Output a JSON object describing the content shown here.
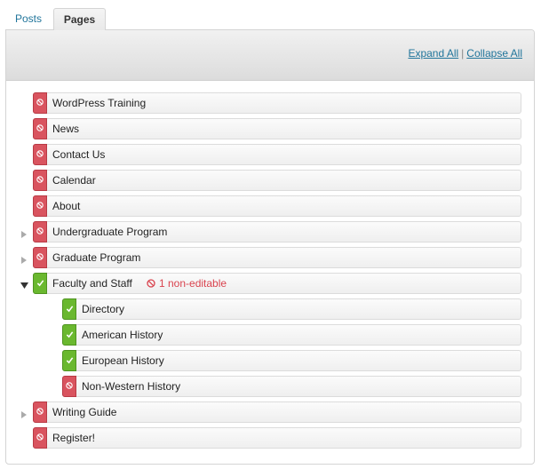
{
  "tabs": [
    {
      "label": "Posts",
      "active": false
    },
    {
      "label": "Pages",
      "active": true
    }
  ],
  "header": {
    "expand_all": "Expand All",
    "separator": "|",
    "collapse_all": "Collapse All"
  },
  "colors": {
    "link": "#21759b",
    "restricted": "#d9545f",
    "editable": "#6ab82f",
    "warning_text": "#d9434e"
  },
  "pages": [
    {
      "label": "WordPress Training",
      "status": "non-editable",
      "depth": 0
    },
    {
      "label": "News",
      "status": "non-editable",
      "depth": 0
    },
    {
      "label": "Contact Us",
      "status": "non-editable",
      "depth": 0
    },
    {
      "label": "Calendar",
      "status": "non-editable",
      "depth": 0
    },
    {
      "label": "About",
      "status": "non-editable",
      "depth": 0
    },
    {
      "label": "Undergraduate Program",
      "status": "non-editable",
      "depth": 0,
      "toggle": "collapsed"
    },
    {
      "label": "Graduate Program",
      "status": "non-editable",
      "depth": 0,
      "toggle": "collapsed"
    },
    {
      "label": "Faculty and Staff",
      "status": "editable",
      "depth": 0,
      "toggle": "expanded",
      "note": "1 non-editable"
    },
    {
      "label": "Directory",
      "status": "editable",
      "depth": 1
    },
    {
      "label": "American History",
      "status": "editable",
      "depth": 1
    },
    {
      "label": "European History",
      "status": "editable",
      "depth": 1
    },
    {
      "label": "Non-Western History",
      "status": "non-editable",
      "depth": 1
    },
    {
      "label": "Writing Guide",
      "status": "non-editable",
      "depth": 0,
      "toggle": "collapsed"
    },
    {
      "label": "Register!",
      "status": "non-editable",
      "depth": 0
    }
  ]
}
